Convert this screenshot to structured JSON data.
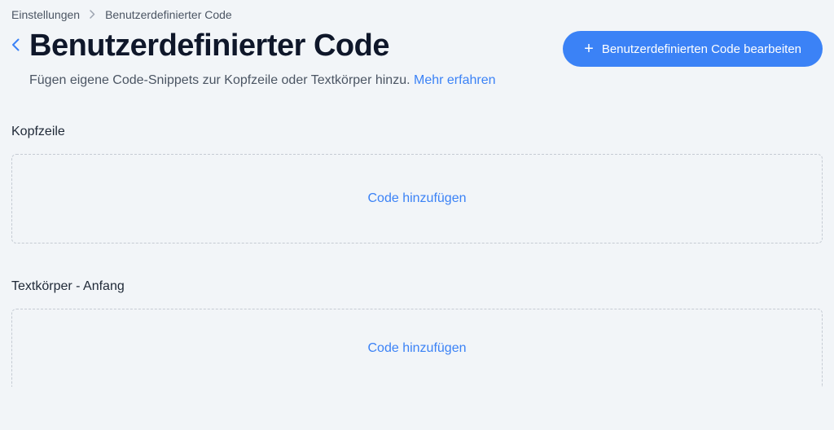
{
  "breadcrumb": {
    "root": "Einstellungen",
    "current": "Benutzerdefinierter Code"
  },
  "header": {
    "title": "Benutzerdefinierter Code",
    "subtitle_prefix": "Fügen eigene Code-Snippets zur Kopfzeile oder Textkörper hinzu. ",
    "learn_more": "Mehr erfahren",
    "edit_button": "Benutzerdefinierten Code bearbeiten"
  },
  "sections": {
    "head": {
      "label": "Kopfzeile",
      "add_code": "Code hinzufügen"
    },
    "body_start": {
      "label": "Textkörper - Anfang",
      "add_code": "Code hinzufügen"
    }
  },
  "colors": {
    "accent": "#3b82f6",
    "bg": "#f2f5f8"
  }
}
